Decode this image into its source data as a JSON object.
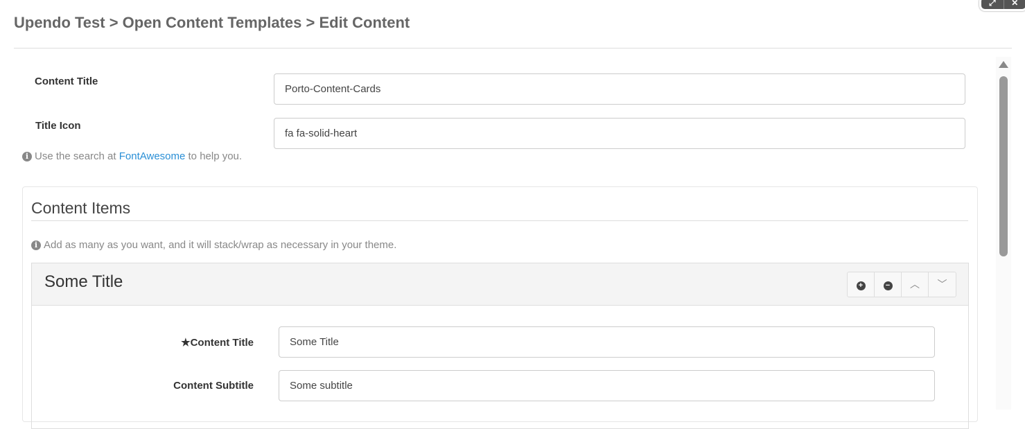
{
  "breadcrumb": "Upendo Test > Open Content Templates > Edit Content",
  "window_controls": {
    "expand_icon": "expand-icon",
    "close_icon": "close-icon"
  },
  "form": {
    "content_title_label": "Content Title",
    "content_title_value": "Porto-Content-Cards",
    "title_icon_label": "Title Icon",
    "title_icon_value": "fa fa-solid-heart",
    "hint_prefix": "Use the search at",
    "hint_link": "FontAwesome",
    "hint_suffix": "to help you."
  },
  "content_items": {
    "heading": "Content Items",
    "hint": "Add as many as you want, and it will stack/wrap as necessary in your theme.",
    "items": [
      {
        "title": "Some Title",
        "fields": [
          {
            "label": "★Content Title",
            "value": "Some Title"
          },
          {
            "label": "Content Subtitle",
            "value": "Some subtitle"
          }
        ]
      }
    ]
  }
}
